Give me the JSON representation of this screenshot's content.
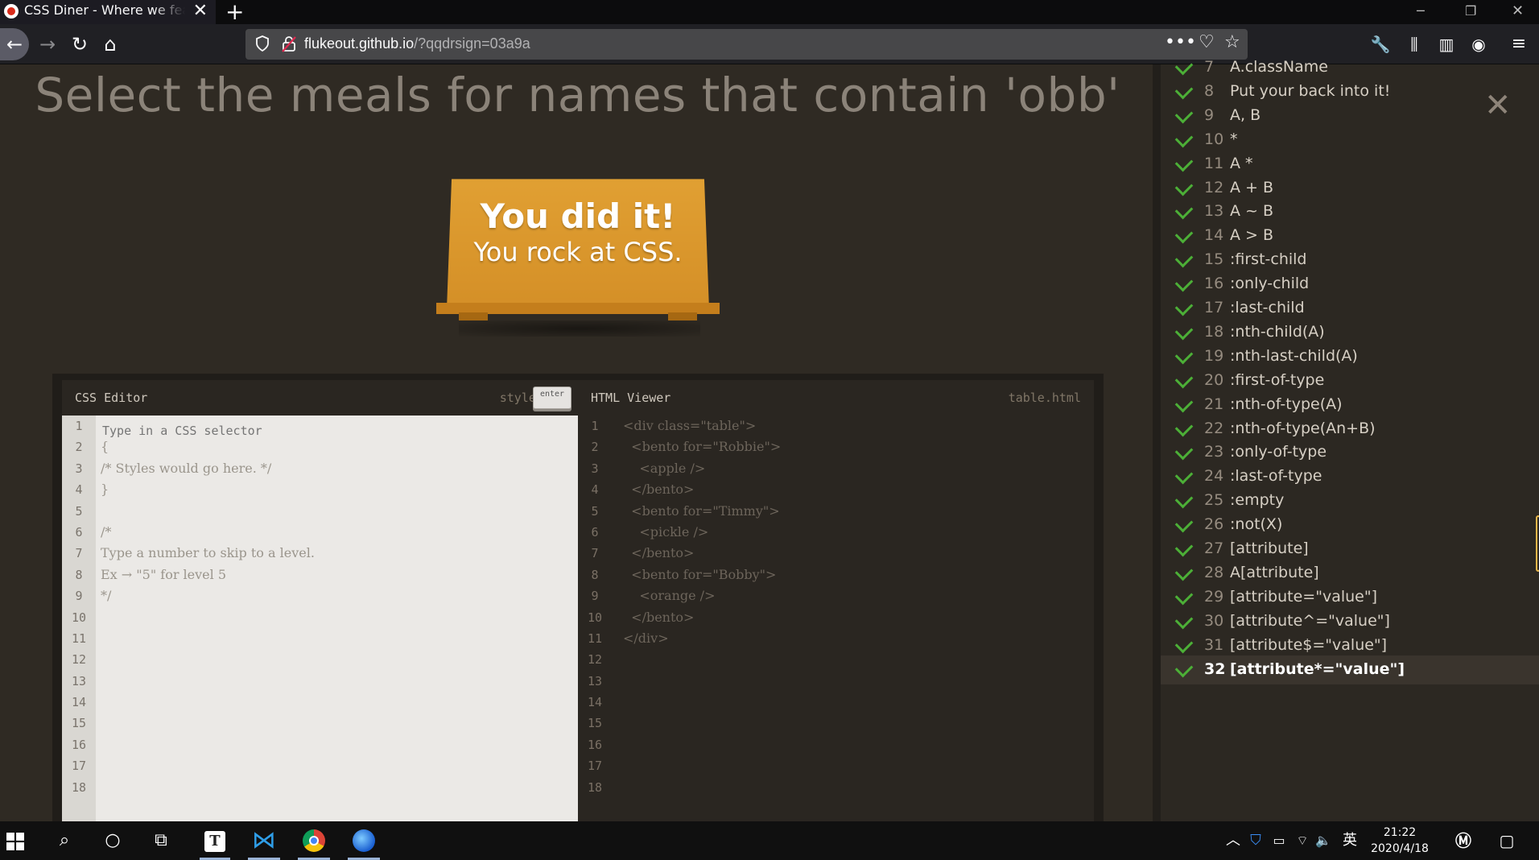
{
  "browser": {
    "tab_title": "CSS Diner - Where we feast on CSS",
    "url_host": "flukeout.github.io",
    "url_query": "/?qqdrsign=03a9a"
  },
  "game": {
    "instruction": "Select the meals for names that contain 'obb'",
    "success_title": "You did it!",
    "success_subtitle": "You rock at CSS."
  },
  "editor": {
    "css_title": "CSS Editor",
    "css_file": "style.css",
    "html_title": "HTML Viewer",
    "html_file": "table.html",
    "css_input_placeholder": "Type in a CSS selector",
    "enter_label": "enter",
    "css_lines": [
      "",
      "{",
      "/* Styles would go here. */",
      "}",
      "",
      "/*",
      "Type a number to skip to a level.",
      "Ex → \"5\" for level 5",
      "*/",
      "",
      "",
      "",
      "",
      "",
      "",
      "",
      "",
      ""
    ],
    "html_lines": [
      "<div class=\"table\">",
      "  <bento for=\"Robbie\">",
      "    <apple />",
      "  </bento>",
      "  <bento for=\"Timmy\">",
      "    <pickle />",
      "  </bento>",
      "  <bento for=\"Bobby\">",
      "    <orange />",
      "  </bento>",
      "</div>",
      "",
      "",
      "",
      "",
      "",
      "",
      ""
    ],
    "line_numbers": [
      "1",
      "2",
      "3",
      "4",
      "5",
      "6",
      "7",
      "8",
      "9",
      "10",
      "11",
      "12",
      "13",
      "14",
      "15",
      "16",
      "17",
      "18"
    ]
  },
  "sidebar": {
    "levels": [
      {
        "num": "7",
        "name": "A.className",
        "done": true
      },
      {
        "num": "8",
        "name": "Put your back into it!",
        "done": true
      },
      {
        "num": "9",
        "name": "A, B",
        "done": true
      },
      {
        "num": "10",
        "name": "*",
        "done": true
      },
      {
        "num": "11",
        "name": "A *",
        "done": true
      },
      {
        "num": "12",
        "name": "A + B",
        "done": true
      },
      {
        "num": "13",
        "name": "A ~ B",
        "done": true
      },
      {
        "num": "14",
        "name": "A > B",
        "done": true
      },
      {
        "num": "15",
        "name": ":first-child",
        "done": true
      },
      {
        "num": "16",
        "name": ":only-child",
        "done": true
      },
      {
        "num": "17",
        "name": ":last-child",
        "done": true
      },
      {
        "num": "18",
        "name": ":nth-child(A)",
        "done": true
      },
      {
        "num": "19",
        "name": ":nth-last-child(A)",
        "done": true
      },
      {
        "num": "20",
        "name": ":first-of-type",
        "done": true
      },
      {
        "num": "21",
        "name": ":nth-of-type(A)",
        "done": true
      },
      {
        "num": "22",
        "name": ":nth-of-type(An+B)",
        "done": true
      },
      {
        "num": "23",
        "name": ":only-of-type",
        "done": true
      },
      {
        "num": "24",
        "name": ":last-of-type",
        "done": true
      },
      {
        "num": "25",
        "name": ":empty",
        "done": true
      },
      {
        "num": "26",
        "name": ":not(X)",
        "done": true
      },
      {
        "num": "27",
        "name": "[attribute]",
        "done": true
      },
      {
        "num": "28",
        "name": "A[attribute]",
        "done": true
      },
      {
        "num": "29",
        "name": "[attribute=\"value\"]",
        "done": true
      },
      {
        "num": "30",
        "name": "[attribute^=\"value\"]",
        "done": true
      },
      {
        "num": "31",
        "name": "[attribute$=\"value\"]",
        "done": true
      },
      {
        "num": "32",
        "name": "[attribute*=\"value\"]",
        "done": true,
        "active": true
      }
    ]
  },
  "taskbar": {
    "time": "21:22",
    "date": "2020/4/18",
    "ime": "英"
  },
  "colors": {
    "check": "#4caf37",
    "table_top": "#e1a033",
    "page_bg": "#2f2a23"
  }
}
